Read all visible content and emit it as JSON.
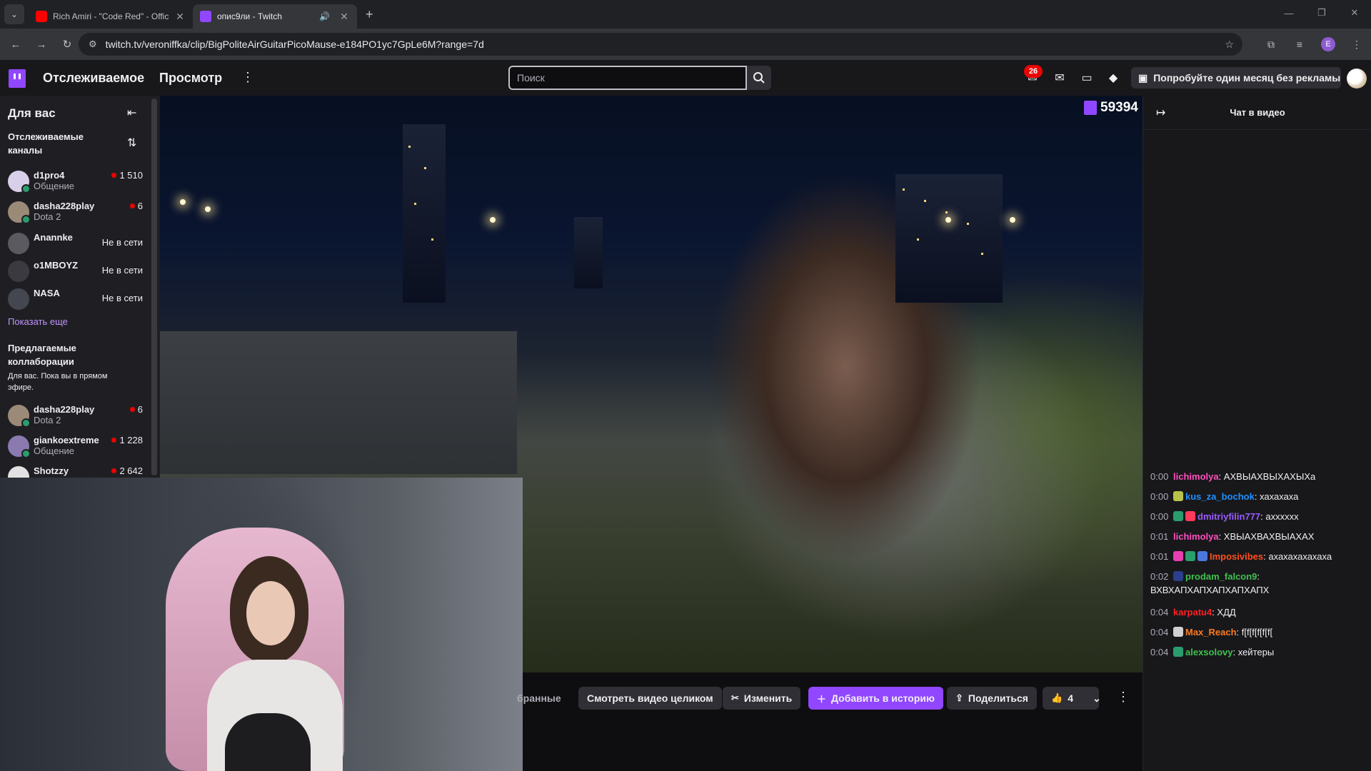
{
  "browser": {
    "tabs": [
      {
        "title": "Rich Amiri - \"Code Red\" - Offic",
        "favicon_color": "#ff0000",
        "active": false
      },
      {
        "title": "опис9ли - Twitch",
        "favicon_color": "#9147ff",
        "active": true
      }
    ],
    "url": "twitch.tv/veroniffka/clip/BigPoliteAirGuitarPicoMause-e184PO1yc7GpLe6M?range=7d",
    "profile_initial": "E"
  },
  "topnav": {
    "following": "Отслеживаемое",
    "browse": "Просмотр",
    "search_placeholder": "Поиск",
    "notification_count": "26",
    "promo": "Попробуйте один месяц без рекламы"
  },
  "sidebar": {
    "title": "Для вас",
    "followed_header": "Отслеживаемые каналы",
    "followed": [
      {
        "name": "d1pro4",
        "game": "Общение",
        "viewers": "1 510",
        "live": true,
        "avatar_color": "#d8cfe8"
      },
      {
        "name": "dasha228play",
        "game": "Dota 2",
        "viewers": "6",
        "live": true,
        "avatar_color": "#9c8a78"
      },
      {
        "name": "Anannke",
        "status": "Не в сети",
        "live": false,
        "avatar_color": "#5a5a60"
      },
      {
        "name": "o1MBOYZ",
        "status": "Не в сети",
        "live": false,
        "avatar_color": "#3a3a40"
      },
      {
        "name": "NASA",
        "status": "Не в сети",
        "live": false,
        "avatar_color": "#44474f"
      }
    ],
    "show_more": "Показать еще",
    "collab_header": "Предлагаемые коллаборации",
    "collab_desc": "Для вас. Пока вы в прямом эфире.",
    "collabs": [
      {
        "name": "dasha228play",
        "game": "Dota 2",
        "viewers": "6",
        "avatar_color": "#9c8a78"
      },
      {
        "name": "giankoextreme",
        "game": "Общение",
        "viewers": "1 228",
        "avatar_color": "#8a7ab0"
      },
      {
        "name": "Shotzzy",
        "game": "",
        "viewers": "2 642",
        "avatar_color": "#e2e2e2"
      }
    ]
  },
  "video": {
    "watermark_count": "59394"
  },
  "actions": {
    "collections": "бранные",
    "watch_full": "Смотреть видео целиком",
    "edit": "Изменить",
    "add_story": "Добавить в историю",
    "share": "Поделиться",
    "likes": "4"
  },
  "chat": {
    "title": "Чат в видео",
    "messages": [
      {
        "time": "0:00",
        "user": "lichimolya",
        "color": "#ff4fbf",
        "text": "АХВЫАХВЫХАХЫХа",
        "badges": []
      },
      {
        "time": "0:00",
        "user": "kus_za_bochok",
        "color": "#1e90ff",
        "text": "хахахаха",
        "badges": [
          "#b8c248"
        ]
      },
      {
        "time": "0:00",
        "user": "dmitriyfilin777",
        "color": "#9a5bff",
        "text": "ахххххх",
        "badges": [
          "#2a9d6e",
          "#ff3b5c"
        ]
      },
      {
        "time": "0:01",
        "user": "lichimolya",
        "color": "#ff4fbf",
        "text": "ХВЫАХВАХВЫАХАХ",
        "badges": []
      },
      {
        "time": "0:01",
        "user": "Imposivibes",
        "color": "#ff4f1f",
        "text": "ахахахахахаха",
        "badges": [
          "#e63fb0",
          "#2a9d6e",
          "#4a78e0"
        ]
      },
      {
        "time": "0:02",
        "user": "prodam_falcon9",
        "color": "#3fc14f",
        "text": "ВХВХАПХАПХАПХАПХАПХ",
        "badges": [
          "#2b3f8a"
        ]
      },
      {
        "time": "0:04",
        "user": "karpatu4",
        "color": "#ff2020",
        "text": "ХДД",
        "badges": []
      },
      {
        "time": "0:04",
        "user": "Max_Reach",
        "color": "#ff7a1f",
        "text": "f[f[f[f[f[f[",
        "badges": [
          "#d0d0d0"
        ]
      },
      {
        "time": "0:04",
        "user": "alexsolovy",
        "color": "#3fc14f",
        "text": "хейтеры",
        "badges": [
          "#2a9d6e"
        ]
      }
    ]
  }
}
